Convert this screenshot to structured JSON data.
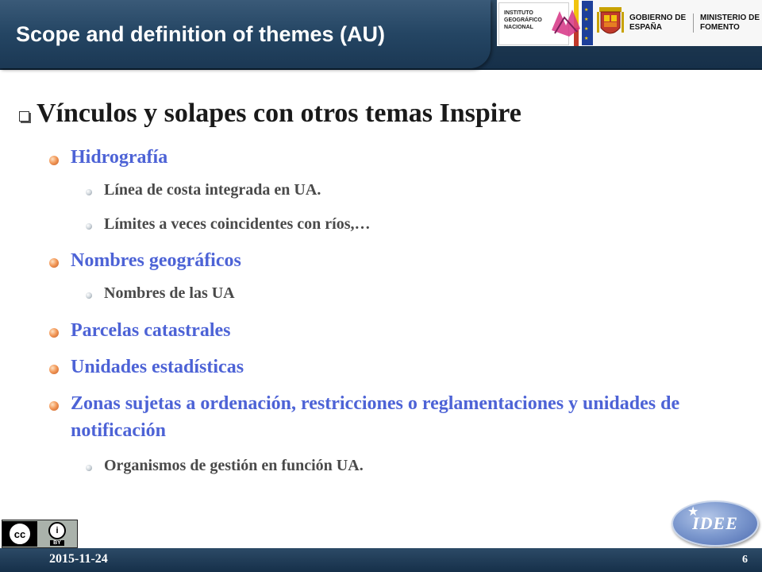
{
  "header": {
    "title": "Scope and definition of themes (AU)",
    "ign_logo_text": "INSTITUTO GEOGRÁFICO NACIONAL",
    "gobierno_text": "GOBIERNO DE ESPAÑA",
    "ministerio_text": "MINISTERIO DE FOMENTO"
  },
  "content": {
    "heading": "Vínculos y solapes con otros temas Inspire",
    "items": [
      {
        "label": "Hidrografía",
        "subitems": [
          "Línea de costa integrada en UA.",
          "Límites a veces coincidentes con ríos,…"
        ]
      },
      {
        "label": "Nombres geográficos",
        "subitems": [
          "Nombres de las UA"
        ]
      },
      {
        "label": "Parcelas catastrales",
        "subitems": []
      },
      {
        "label": "Unidades estadísticas",
        "subitems": []
      },
      {
        "label": "Zonas sujetas a ordenación, restricciones o reglamentaciones y unidades de notificación",
        "subitems": [
          "Organismos de gestión en función UA."
        ]
      }
    ]
  },
  "footer": {
    "date": "2015-11-24",
    "page_number": "6",
    "cc_label": "cc",
    "by_label": "BY",
    "idee_label": "IDEE"
  },
  "colors": {
    "header_bg": "#1e3850",
    "level2_text": "#4d63d6",
    "level3_text": "#4a4a4a"
  }
}
